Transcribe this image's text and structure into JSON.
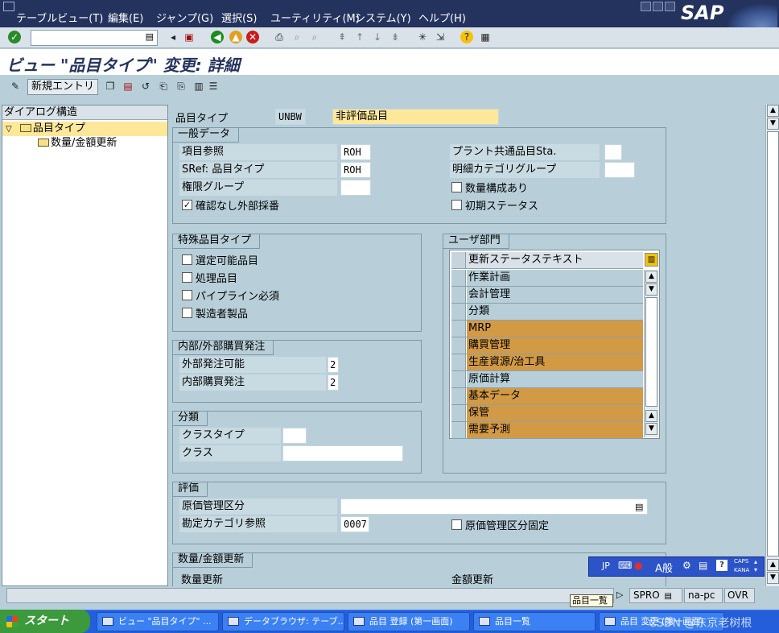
{
  "menu": [
    "テーブルビュー(T)",
    "編集(E)",
    "ジャンプ(G)",
    "選択(S)",
    "ユーティリティ(M)",
    "システム(Y)",
    "ヘルプ(H)"
  ],
  "logo": "SAP",
  "title": "ビュー \"品目タイプ\" 変更: 詳細",
  "toolbar2": {
    "new_entries": "新規エントリ"
  },
  "tree": {
    "header": "ダイアログ構造",
    "items": [
      {
        "label": "品目タイプ",
        "selected": true
      },
      {
        "label": "数量/金額更新",
        "selected": false
      }
    ]
  },
  "header_field": {
    "label": "品目タイプ",
    "code": "UNBW",
    "description": "非評価品目"
  },
  "general": {
    "title": "一般データ",
    "item_ref_label": "項目参照",
    "item_ref_value": "ROH",
    "sref_label": "SRef: 品目タイプ",
    "sref_value": "ROH",
    "auth_group_label": "権限グループ",
    "auth_group_value": "",
    "ext_num_label": "確認なし外部採番",
    "ext_num_checked": true,
    "plant_status_label": "プラント共通品目Sta.",
    "plant_status_value": "",
    "item_cat_group_label": "明細カテゴリグループ",
    "item_cat_group_value": "",
    "qty_structure_label": "数量構成あり",
    "qty_structure_checked": false,
    "initial_status_label": "初期ステータス",
    "initial_status_checked": false
  },
  "special": {
    "title": "特殊品目タイプ",
    "items": [
      {
        "label": "選定可能品目",
        "checked": false
      },
      {
        "label": "処理品目",
        "checked": false
      },
      {
        "label": "パイプライン必須",
        "checked": false
      },
      {
        "label": "製造者製品",
        "checked": false
      }
    ]
  },
  "purchase": {
    "title": "内部/外部購買発注",
    "external_label": "外部発注可能",
    "external_value": "2",
    "internal_label": "内部購買発注",
    "internal_value": "2"
  },
  "classification": {
    "title": "分類",
    "class_type_label": "クラスタイプ",
    "class_type_value": "",
    "class_label": "クラス",
    "class_value": ""
  },
  "user_dept": {
    "title": "ユーザ部門",
    "column_header": "更新ステータステキスト",
    "rows": [
      {
        "label": "作業計画",
        "highlight": false
      },
      {
        "label": "会計管理",
        "highlight": false
      },
      {
        "label": "分類",
        "highlight": false
      },
      {
        "label": "MRP",
        "highlight": true
      },
      {
        "label": "購買管理",
        "highlight": true
      },
      {
        "label": "生産資源/治工具",
        "highlight": true
      },
      {
        "label": "原価計算",
        "highlight": false
      },
      {
        "label": "基本データ",
        "highlight": true
      },
      {
        "label": "保管",
        "highlight": true
      },
      {
        "label": "需要予測",
        "highlight": true
      }
    ],
    "highlight_color": "#d39a45"
  },
  "valuation": {
    "title": "評価",
    "price_ctrl_label": "原価管理区分",
    "price_ctrl_value": "",
    "acct_cat_label": "勘定カテゴリ参照",
    "acct_cat_value": "0007",
    "price_ctrl_fixed_label": "原価管理区分固定",
    "price_ctrl_fixed_checked": false
  },
  "qty_value": {
    "title": "数量/金額更新",
    "qty_label": "数量更新",
    "value_label": "金額更新"
  },
  "ime": {
    "lang": "JP",
    "mode": "A般",
    "caps": "CAPS",
    "kana": "KANA"
  },
  "status": {
    "tooltip": "品目一覧",
    "transaction": "SPRO",
    "server": "na-pc",
    "mode": "OVR"
  },
  "taskbar": {
    "start": "スタート",
    "tasks": [
      "ビュー \"品目タイプ\" ...",
      "データブラウザ: テーブ...",
      "品目 登録 (第一画面)",
      "品目一覧",
      "品目 変更 (第一画面)"
    ],
    "watermark": "CSDN @东京老树根"
  },
  "colors": {
    "accent": "#24335e",
    "background": "#b8cfd9",
    "required_field": "#fde89a"
  }
}
